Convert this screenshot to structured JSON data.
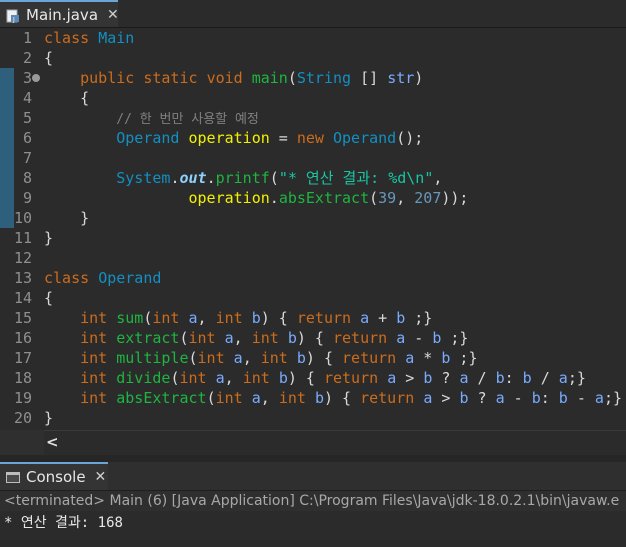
{
  "editor_tab": {
    "label": "Main.java",
    "close": "✕"
  },
  "code": {
    "line_numbers": [
      "1",
      "2",
      "3",
      "4",
      "5",
      "6",
      "7",
      "8",
      "9",
      "10",
      "11",
      "12",
      "13",
      "14",
      "15",
      "16",
      "17",
      "18",
      "19",
      "20"
    ],
    "lines": [
      [
        {
          "t": "class ",
          "c": "kw"
        },
        {
          "t": "Main",
          "c": "cls"
        }
      ],
      [
        {
          "t": "{",
          "c": ""
        }
      ],
      [
        {
          "t": "    ",
          "c": ""
        },
        {
          "t": "public",
          "c": "kw"
        },
        {
          "t": " ",
          "c": ""
        },
        {
          "t": "static",
          "c": "kw"
        },
        {
          "t": " ",
          "c": ""
        },
        {
          "t": "void",
          "c": "kw"
        },
        {
          "t": " ",
          "c": ""
        },
        {
          "t": "main",
          "c": "fn"
        },
        {
          "t": "(",
          "c": ""
        },
        {
          "t": "String",
          "c": "cls"
        },
        {
          "t": " [] ",
          "c": ""
        },
        {
          "t": "str",
          "c": "par"
        },
        {
          "t": ")",
          "c": ""
        }
      ],
      [
        {
          "t": "    {",
          "c": ""
        }
      ],
      [
        {
          "t": "        ",
          "c": ""
        },
        {
          "t": "// 한 번만 사용할 예정",
          "c": "cmt"
        }
      ],
      [
        {
          "t": "        ",
          "c": ""
        },
        {
          "t": "Operand",
          "c": "cls"
        },
        {
          "t": " ",
          "c": ""
        },
        {
          "t": "operation",
          "c": "var"
        },
        {
          "t": " = ",
          "c": ""
        },
        {
          "t": "new",
          "c": "kw"
        },
        {
          "t": " ",
          "c": ""
        },
        {
          "t": "Operand",
          "c": "cls"
        },
        {
          "t": "();",
          "c": ""
        }
      ],
      [
        {
          "t": "",
          "c": ""
        }
      ],
      [
        {
          "t": "        ",
          "c": ""
        },
        {
          "t": "System",
          "c": "cls"
        },
        {
          "t": ".",
          "c": ""
        },
        {
          "t": "out",
          "c": "fld"
        },
        {
          "t": ".",
          "c": ""
        },
        {
          "t": "printf",
          "c": "mtd"
        },
        {
          "t": "(",
          "c": ""
        },
        {
          "t": "\"* 연산 결과: %d\\n\"",
          "c": "str"
        },
        {
          "t": ",",
          "c": ""
        }
      ],
      [
        {
          "t": "                ",
          "c": ""
        },
        {
          "t": "operation",
          "c": "var"
        },
        {
          "t": ".",
          "c": ""
        },
        {
          "t": "absExtract",
          "c": "mtd"
        },
        {
          "t": "(",
          "c": ""
        },
        {
          "t": "39",
          "c": "num"
        },
        {
          "t": ", ",
          "c": ""
        },
        {
          "t": "207",
          "c": "num"
        },
        {
          "t": "));",
          "c": ""
        }
      ],
      [
        {
          "t": "    }",
          "c": ""
        }
      ],
      [
        {
          "t": "}",
          "c": ""
        }
      ],
      [
        {
          "t": "",
          "c": ""
        }
      ],
      [
        {
          "t": "class ",
          "c": "kw"
        },
        {
          "t": "Operand",
          "c": "cls"
        }
      ],
      [
        {
          "t": "{",
          "c": ""
        }
      ],
      [
        {
          "t": "    ",
          "c": ""
        },
        {
          "t": "int",
          "c": "kw"
        },
        {
          "t": " ",
          "c": ""
        },
        {
          "t": "sum",
          "c": "fn"
        },
        {
          "t": "(",
          "c": ""
        },
        {
          "t": "int",
          "c": "kw"
        },
        {
          "t": " ",
          "c": ""
        },
        {
          "t": "a",
          "c": "par"
        },
        {
          "t": ", ",
          "c": ""
        },
        {
          "t": "int",
          "c": "kw"
        },
        {
          "t": " ",
          "c": ""
        },
        {
          "t": "b",
          "c": "par"
        },
        {
          "t": ") { ",
          "c": ""
        },
        {
          "t": "return",
          "c": "kw"
        },
        {
          "t": " ",
          "c": ""
        },
        {
          "t": "a",
          "c": "par"
        },
        {
          "t": " + ",
          "c": ""
        },
        {
          "t": "b",
          "c": "par"
        },
        {
          "t": " ;}",
          "c": ""
        }
      ],
      [
        {
          "t": "    ",
          "c": ""
        },
        {
          "t": "int",
          "c": "kw"
        },
        {
          "t": " ",
          "c": ""
        },
        {
          "t": "extract",
          "c": "fn"
        },
        {
          "t": "(",
          "c": ""
        },
        {
          "t": "int",
          "c": "kw"
        },
        {
          "t": " ",
          "c": ""
        },
        {
          "t": "a",
          "c": "par"
        },
        {
          "t": ", ",
          "c": ""
        },
        {
          "t": "int",
          "c": "kw"
        },
        {
          "t": " ",
          "c": ""
        },
        {
          "t": "b",
          "c": "par"
        },
        {
          "t": ") { ",
          "c": ""
        },
        {
          "t": "return",
          "c": "kw"
        },
        {
          "t": " ",
          "c": ""
        },
        {
          "t": "a",
          "c": "par"
        },
        {
          "t": " - ",
          "c": ""
        },
        {
          "t": "b",
          "c": "par"
        },
        {
          "t": " ;}",
          "c": ""
        }
      ],
      [
        {
          "t": "    ",
          "c": ""
        },
        {
          "t": "int",
          "c": "kw"
        },
        {
          "t": " ",
          "c": ""
        },
        {
          "t": "multiple",
          "c": "fn"
        },
        {
          "t": "(",
          "c": ""
        },
        {
          "t": "int",
          "c": "kw"
        },
        {
          "t": " ",
          "c": ""
        },
        {
          "t": "a",
          "c": "par"
        },
        {
          "t": ", ",
          "c": ""
        },
        {
          "t": "int",
          "c": "kw"
        },
        {
          "t": " ",
          "c": ""
        },
        {
          "t": "b",
          "c": "par"
        },
        {
          "t": ") { ",
          "c": ""
        },
        {
          "t": "return",
          "c": "kw"
        },
        {
          "t": " ",
          "c": ""
        },
        {
          "t": "a",
          "c": "par"
        },
        {
          "t": " * ",
          "c": ""
        },
        {
          "t": "b",
          "c": "par"
        },
        {
          "t": " ;}",
          "c": ""
        }
      ],
      [
        {
          "t": "    ",
          "c": ""
        },
        {
          "t": "int",
          "c": "kw"
        },
        {
          "t": " ",
          "c": ""
        },
        {
          "t": "divide",
          "c": "fn"
        },
        {
          "t": "(",
          "c": ""
        },
        {
          "t": "int",
          "c": "kw"
        },
        {
          "t": " ",
          "c": ""
        },
        {
          "t": "a",
          "c": "par"
        },
        {
          "t": ", ",
          "c": ""
        },
        {
          "t": "int",
          "c": "kw"
        },
        {
          "t": " ",
          "c": ""
        },
        {
          "t": "b",
          "c": "par"
        },
        {
          "t": ") { ",
          "c": ""
        },
        {
          "t": "return",
          "c": "kw"
        },
        {
          "t": " ",
          "c": ""
        },
        {
          "t": "a",
          "c": "par"
        },
        {
          "t": " > ",
          "c": ""
        },
        {
          "t": "b",
          "c": "par"
        },
        {
          "t": " ? ",
          "c": ""
        },
        {
          "t": "a",
          "c": "par"
        },
        {
          "t": " / ",
          "c": ""
        },
        {
          "t": "b",
          "c": "par"
        },
        {
          "t": ": ",
          "c": ""
        },
        {
          "t": "b",
          "c": "par"
        },
        {
          "t": " / ",
          "c": ""
        },
        {
          "t": "a",
          "c": "par"
        },
        {
          "t": ";}",
          "c": ""
        }
      ],
      [
        {
          "t": "    ",
          "c": ""
        },
        {
          "t": "int",
          "c": "kw"
        },
        {
          "t": " ",
          "c": ""
        },
        {
          "t": "absExtract",
          "c": "fn"
        },
        {
          "t": "(",
          "c": ""
        },
        {
          "t": "int",
          "c": "kw"
        },
        {
          "t": " ",
          "c": ""
        },
        {
          "t": "a",
          "c": "par"
        },
        {
          "t": ", ",
          "c": ""
        },
        {
          "t": "int",
          "c": "kw"
        },
        {
          "t": " ",
          "c": ""
        },
        {
          "t": "b",
          "c": "par"
        },
        {
          "t": ") { ",
          "c": ""
        },
        {
          "t": "return",
          "c": "kw"
        },
        {
          "t": " ",
          "c": ""
        },
        {
          "t": "a",
          "c": "par"
        },
        {
          "t": " > ",
          "c": ""
        },
        {
          "t": "b",
          "c": "par"
        },
        {
          "t": " ? ",
          "c": ""
        },
        {
          "t": "a",
          "c": "par"
        },
        {
          "t": " - ",
          "c": ""
        },
        {
          "t": "b",
          "c": "par"
        },
        {
          "t": ": ",
          "c": ""
        },
        {
          "t": "b",
          "c": "par"
        },
        {
          "t": " - ",
          "c": ""
        },
        {
          "t": "a",
          "c": "par"
        },
        {
          "t": ";}",
          "c": ""
        }
      ],
      [
        {
          "t": "}",
          "c": ""
        }
      ]
    ]
  },
  "scroll": {
    "left_arrow": "<"
  },
  "console_tab": {
    "label": "Console",
    "close": "✕"
  },
  "console": {
    "status": "<terminated> Main (6) [Java Application] C:\\Program Files\\Java\\jdk-18.0.2.1\\bin\\javaw.e",
    "output": "* 연산 결과: 168"
  },
  "colors": {
    "accent": "#6aa7d8",
    "keyword": "#cc6c1d",
    "class": "#1290c3",
    "string": "#17c6a3",
    "variable": "#f2f200"
  },
  "icons": {
    "editor_tab": "java-file-icon",
    "console_tab": "console-icon",
    "fold": "fold-collapse-icon"
  }
}
